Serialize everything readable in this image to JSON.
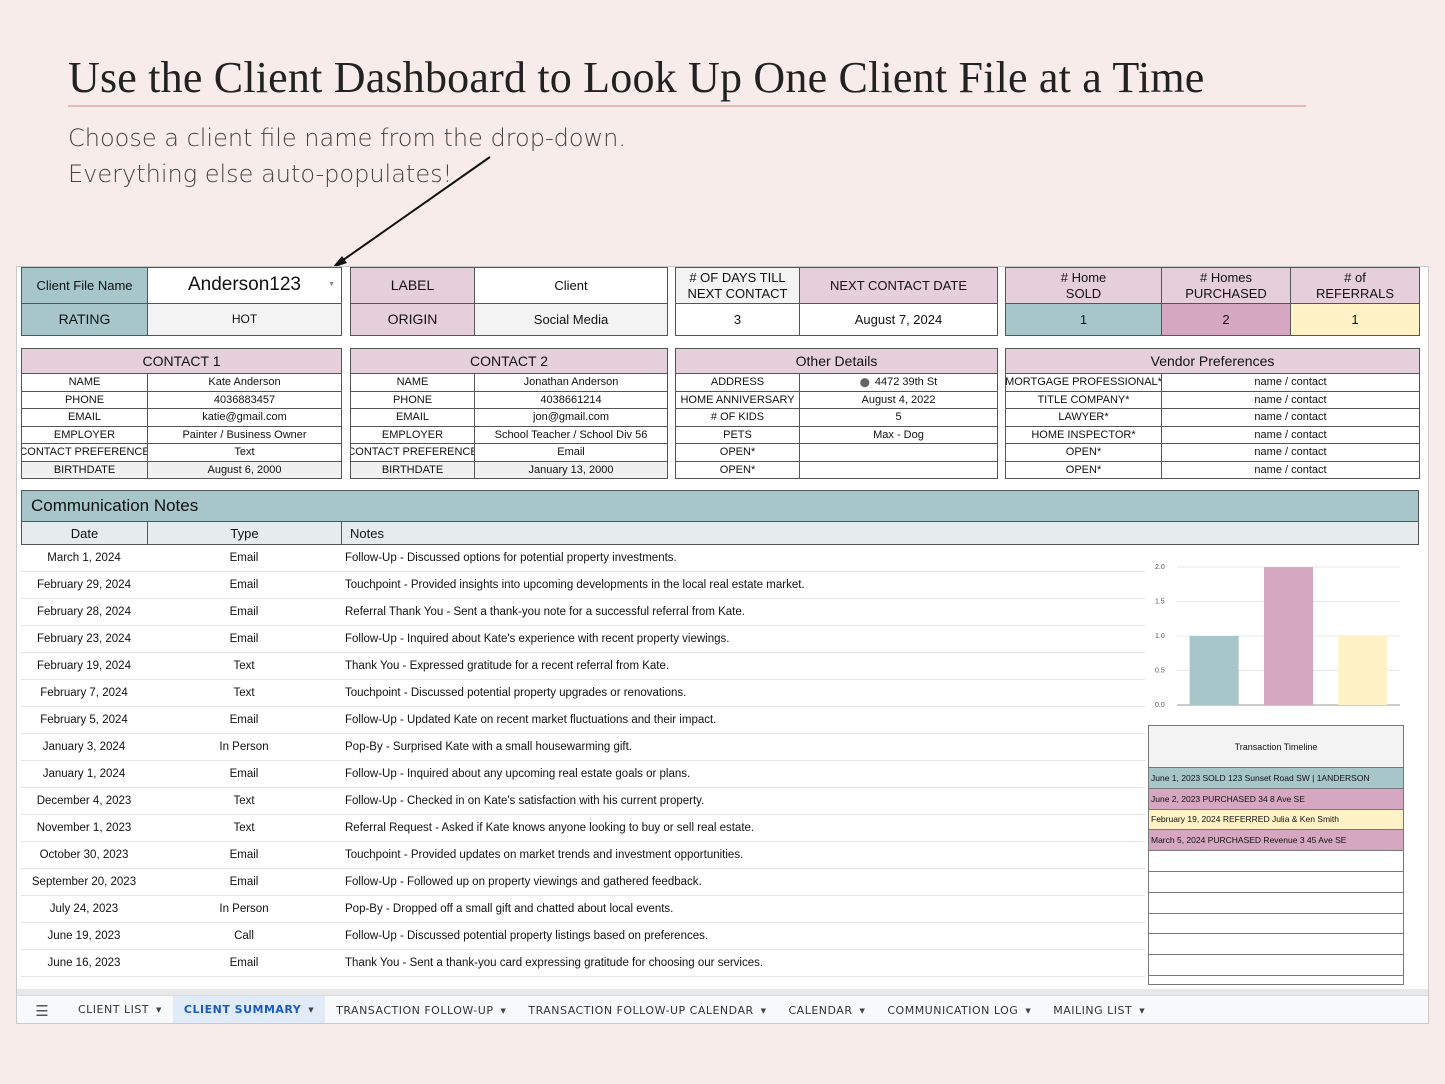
{
  "heading": {
    "title": "Use the Client Dashboard to Look Up One Client File at a Time",
    "line1": "Choose a client file name from the drop-down.",
    "line2": "Everything else auto-populates!"
  },
  "client": {
    "file_label": "Client File Name",
    "file_value": "Anderson123",
    "rating_label": "RATING",
    "rating_value": "HOT",
    "label_label": "LABEL",
    "label_value": "Client",
    "origin_label": "ORIGIN",
    "origin_value": "Social Media",
    "days_label_1": "# OF DAYS TILL",
    "days_label_2": "NEXT CONTACT",
    "days_value": "3",
    "next_label": "NEXT CONTACT DATE",
    "next_value": "August 7, 2024",
    "sold_label_1": "# Home",
    "sold_label_2": "SOLD",
    "sold_value": "1",
    "purchased_label_1": "# Homes",
    "purchased_label_2": "PURCHASED",
    "purchased_value": "2",
    "referrals_label_1": "# of",
    "referrals_label_2": "REFERRALS",
    "referrals_value": "1"
  },
  "contact1": {
    "title": "CONTACT 1",
    "rows": [
      {
        "k": "NAME",
        "v": "Kate Anderson"
      },
      {
        "k": "PHONE",
        "v": "4036883457"
      },
      {
        "k": "EMAIL",
        "v": "katie@gmail.com"
      },
      {
        "k": "EMPLOYER",
        "v": "Painter / Business Owner"
      },
      {
        "k": "CONTACT PREFERENCE",
        "v": "Text"
      },
      {
        "k": "BIRTHDATE",
        "v": "August 6, 2000"
      }
    ]
  },
  "contact2": {
    "title": "CONTACT 2",
    "rows": [
      {
        "k": "NAME",
        "v": "Jonathan Anderson"
      },
      {
        "k": "PHONE",
        "v": "4038661214"
      },
      {
        "k": "EMAIL",
        "v": "jon@gmail.com"
      },
      {
        "k": "EMPLOYER",
        "v": "School Teacher / School Div 56"
      },
      {
        "k": "CONTACT PREFERENCE",
        "v": "Email"
      },
      {
        "k": "BIRTHDATE",
        "v": "January 13, 2000"
      }
    ]
  },
  "other": {
    "title": "Other Details",
    "rows": [
      {
        "k": "ADDRESS",
        "v": "4472 39th St"
      },
      {
        "k": "HOME ANNIVERSARY",
        "v": "August 4, 2022"
      },
      {
        "k": "# OF KIDS",
        "v": "5"
      },
      {
        "k": "PETS",
        "v": "Max - Dog"
      },
      {
        "k": "OPEN*",
        "v": ""
      },
      {
        "k": "OPEN*",
        "v": ""
      }
    ]
  },
  "vendors": {
    "title": "Vendor Preferences",
    "rows": [
      {
        "k": "MORTGAGE PROFESSIONAL*",
        "v": "name / contact"
      },
      {
        "k": "TITLE COMPANY*",
        "v": "name / contact"
      },
      {
        "k": "LAWYER*",
        "v": "name / contact"
      },
      {
        "k": "HOME INSPECTOR*",
        "v": "name / contact"
      },
      {
        "k": "OPEN*",
        "v": "name / contact"
      },
      {
        "k": "OPEN*",
        "v": "name / contact"
      }
    ]
  },
  "communication": {
    "title": "Communication Notes",
    "headers": [
      "Date",
      "Type",
      "Notes"
    ],
    "rows": [
      {
        "date": "March 1, 2024",
        "type": "Email",
        "note": "Follow-Up - Discussed options for potential property investments."
      },
      {
        "date": "February 29, 2024",
        "type": "Email",
        "note": "Touchpoint - Provided insights into upcoming developments in the local real estate market."
      },
      {
        "date": "February 28, 2024",
        "type": "Email",
        "note": "Referral Thank You - Sent a thank-you note for a successful referral from Kate."
      },
      {
        "date": "February 23, 2024",
        "type": "Email",
        "note": "Follow-Up - Inquired about Kate's experience with recent property viewings."
      },
      {
        "date": "February 19, 2024",
        "type": "Text",
        "note": "Thank You - Expressed gratitude for a recent referral from Kate."
      },
      {
        "date": "February 7, 2024",
        "type": "Text",
        "note": "Touchpoint - Discussed potential property upgrades or renovations."
      },
      {
        "date": "February 5, 2024",
        "type": "Email",
        "note": "Follow-Up - Updated Kate on recent market fluctuations and their impact."
      },
      {
        "date": "January 3, 2024",
        "type": "In Person",
        "note": "Pop-By - Surprised Kate with a small housewarming gift."
      },
      {
        "date": "January 1, 2024",
        "type": "Email",
        "note": "Follow-Up - Inquired about any upcoming real estate goals or plans."
      },
      {
        "date": "December 4, 2023",
        "type": "Text",
        "note": "Follow-Up - Checked in on Kate's satisfaction with his current property."
      },
      {
        "date": "November 1, 2023",
        "type": "Text",
        "note": "Referral Request - Asked if Kate knows anyone looking to buy or sell real estate."
      },
      {
        "date": "October 30, 2023",
        "type": "Email",
        "note": "Touchpoint - Provided updates on market trends and investment opportunities."
      },
      {
        "date": "September 20, 2023",
        "type": "Email",
        "note": "Follow-Up - Followed up on property viewings and gathered feedback."
      },
      {
        "date": "July 24, 2023",
        "type": "In Person",
        "note": "Pop-By - Dropped off a small gift and chatted about local events."
      },
      {
        "date": "June 19, 2023",
        "type": "Call",
        "note": "Follow-Up - Discussed potential property listings based on preferences."
      },
      {
        "date": "June 16, 2023",
        "type": "Email",
        "note": "Thank You - Sent a thank-you card expressing gratitude for choosing our services."
      }
    ]
  },
  "chart_data": {
    "type": "bar",
    "categories": [
      "",
      "",
      ""
    ],
    "values": [
      1,
      2,
      1
    ],
    "colors": [
      "#a6c6c9",
      "#d6a7c1",
      "#fff2c6"
    ],
    "ylim": [
      0,
      2
    ],
    "yticks": [
      "0.0",
      "0.5",
      "1.0",
      "1.5",
      "2.0"
    ],
    "title": "",
    "xlabel": "",
    "ylabel": ""
  },
  "timeline": {
    "title": "Transaction Timeline",
    "rows": [
      {
        "text": "June 1, 2023 SOLD 123 Sunset Road SW | 1ANDERSON",
        "color": "#a6c6c9"
      },
      {
        "text": "June 2, 2023 PURCHASED 34 8 Ave SE",
        "color": "#d6a7c1"
      },
      {
        "text": "February 19, 2024 REFERRED Julia & Ken Smith",
        "color": "#fff2c6"
      },
      {
        "text": "March 5, 2024 PURCHASED Revenue 3 45 Ave SE",
        "color": "#d6a7c1"
      },
      {
        "text": "",
        "color": "#ffffff"
      },
      {
        "text": "",
        "color": "#ffffff"
      },
      {
        "text": "",
        "color": "#ffffff"
      },
      {
        "text": "",
        "color": "#ffffff"
      },
      {
        "text": "",
        "color": "#ffffff"
      },
      {
        "text": "",
        "color": "#ffffff"
      }
    ]
  },
  "tabs": [
    "CLIENT LIST",
    "CLIENT SUMMARY",
    "TRANSACTION FOLLOW-UP",
    "TRANSACTION FOLLOW-UP CALENDAR",
    "CALENDAR",
    "COMMUNICATION LOG",
    "MAILING LIST"
  ],
  "active_tab": "CLIENT SUMMARY",
  "icons": {
    "menu": "hamburger-menu-icon",
    "dropdown": "caret-down-icon",
    "pin": "map-pin-icon"
  }
}
